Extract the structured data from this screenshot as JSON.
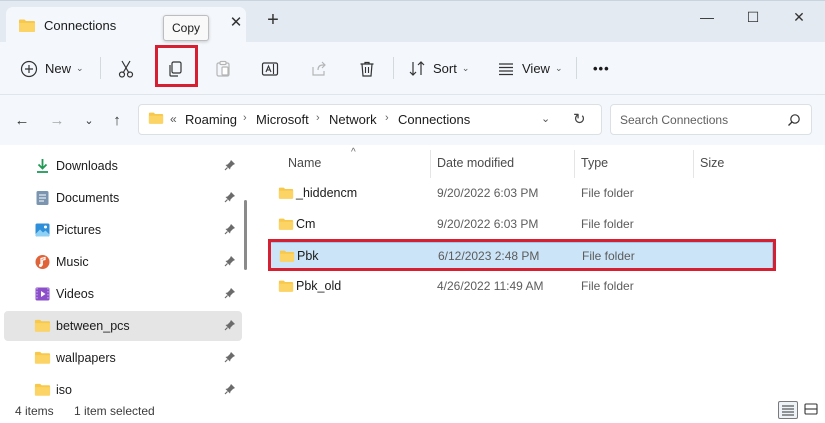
{
  "window": {
    "tab_title": "Connections",
    "new_tab": "+",
    "tab_close": "✕",
    "minimize": "—",
    "maximize": "☐",
    "close": "✕"
  },
  "tooltip": {
    "text": "Copy"
  },
  "toolbar": {
    "new_label": "New",
    "sort_label": "Sort",
    "view_label": "View",
    "more": "•••"
  },
  "address": {
    "overflow": "«",
    "crumbs": [
      "Roaming",
      "Microsoft",
      "Network",
      "Connections"
    ],
    "separator": "›",
    "search_placeholder": "Search Connections"
  },
  "nav": {
    "items": [
      {
        "label": "Downloads",
        "icon": "download-icon",
        "pinned": true
      },
      {
        "label": "Documents",
        "icon": "documents-icon",
        "pinned": true
      },
      {
        "label": "Pictures",
        "icon": "pictures-icon",
        "pinned": true
      },
      {
        "label": "Music",
        "icon": "music-icon",
        "pinned": true
      },
      {
        "label": "Videos",
        "icon": "videos-icon",
        "pinned": true
      },
      {
        "label": "between_pcs",
        "icon": "folder-icon",
        "pinned": true,
        "selected": true
      },
      {
        "label": "wallpapers",
        "icon": "folder-icon",
        "pinned": true
      },
      {
        "label": "iso",
        "icon": "folder-icon",
        "pinned": true
      }
    ]
  },
  "files": {
    "columns": [
      "Name",
      "Date modified",
      "Type",
      "Size"
    ],
    "sort_indicator": "^",
    "rows": [
      {
        "name": "_hiddencm",
        "date": "9/20/2022 6:03 PM",
        "type": "File folder"
      },
      {
        "name": "Cm",
        "date": "9/20/2022 6:03 PM",
        "type": "File folder"
      },
      {
        "name": "Pbk",
        "date": "6/12/2023 2:48 PM",
        "type": "File folder",
        "selected": true
      },
      {
        "name": "Pbk_old",
        "date": "4/26/2022 11:49 AM",
        "type": "File folder"
      }
    ]
  },
  "status": {
    "count": "4 items",
    "selection": "1 item selected"
  },
  "colors": {
    "accent_highlight": "#d62032",
    "selection_bg": "#cce4f7",
    "folder_yellow": "#f8c84a"
  }
}
